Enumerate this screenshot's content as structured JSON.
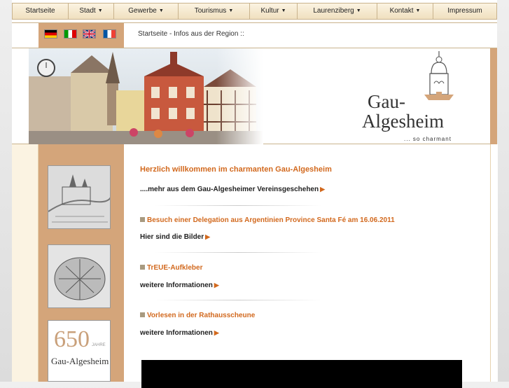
{
  "nav": {
    "items": [
      {
        "label": "Startseite",
        "dropdown": false
      },
      {
        "label": "Stadt",
        "dropdown": true
      },
      {
        "label": "Gewerbe",
        "dropdown": true
      },
      {
        "label": "Tourismus",
        "dropdown": true
      },
      {
        "label": "Kultur",
        "dropdown": true
      },
      {
        "label": "Laurenziberg",
        "dropdown": true
      },
      {
        "label": "Kontakt",
        "dropdown": true
      },
      {
        "label": "Impressum",
        "dropdown": false
      }
    ]
  },
  "lang": {
    "flags": [
      "german-flag-icon",
      "italian-flag-icon",
      "british-flag-icon",
      "french-flag-icon"
    ]
  },
  "breadcrumb": "Startseite - Infos aus der Region ::",
  "logo": {
    "line1": "Gau-",
    "line2": "Algesheim",
    "tagline": "... so charmant"
  },
  "thumbs": {
    "jubilee_number": "650",
    "jubilee_word": "JAHRE",
    "jubilee_name": "Gau-Algesheim"
  },
  "content": {
    "welcome": "Herzlich willkommen im charmanten Gau-Algesheim",
    "more_link": "....mehr aus dem Gau-Algesheimer Vereinsgeschehen",
    "news": [
      {
        "headline": "Besuch einer Delegation aus Argentinien Province Santa Fé am 16.06.2011",
        "link": "Hier sind die Bilder"
      },
      {
        "headline": "TrEUE-Aufkleber",
        "link": "weitere Informationen"
      },
      {
        "headline": "Vorlesen in der Rathausscheune",
        "link": "weitere Informationen"
      }
    ]
  },
  "colors": {
    "accent": "#d2691e",
    "brown_band": "#d4a57a",
    "nav_bg": "#f7ecd6"
  }
}
